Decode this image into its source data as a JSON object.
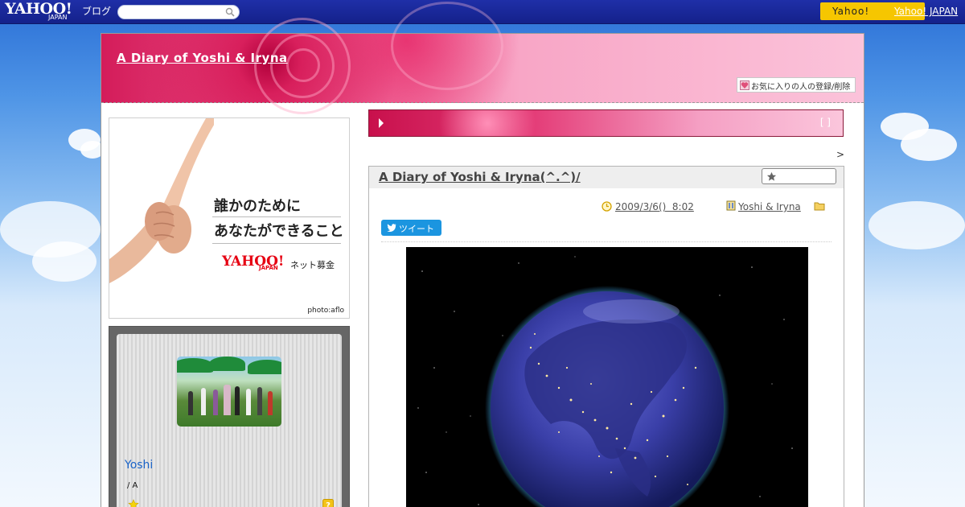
{
  "topbar": {
    "logo_text": "YAHOO!",
    "logo_sub": "JAPAN",
    "blog_label": "ブログ",
    "search_placeholder": "",
    "yahoo_button_label": "Yahoo!",
    "yahoo_japan_link": "Yahoo! JAPAN"
  },
  "header": {
    "blog_title": "A Diary of Yoshi & Iryna",
    "favorite_button": "お気に入りの人の登録/削除"
  },
  "sidebar": {
    "ad": {
      "line1": "誰かのために",
      "line2": "あなたができること",
      "logo": "YAHOO!",
      "logo_sub": "JAPAN",
      "service": "ネット募金",
      "credit": "photo:aflo"
    },
    "profile": {
      "name": "Yoshi",
      "subtext": "/ A"
    }
  },
  "banner": {
    "bracket": "[ ]"
  },
  "nav": {
    "next": ">"
  },
  "post": {
    "title": "A Diary of Yoshi & Iryna(^.^)/",
    "date": "2009/3/6()  8:02",
    "author": "Yoshi & Iryna",
    "tweet_label": "ツイート"
  },
  "colors": {
    "topbar": "#1f2fa8",
    "yahoo_button": "#f6c600",
    "profile_name": "#1a63c8",
    "tweet": "#1b95e0",
    "header_pink": "#e43d78"
  }
}
